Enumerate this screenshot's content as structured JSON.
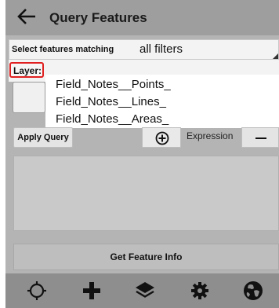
{
  "header": {
    "title": "Query Features",
    "back_icon": "back-arrow-icon"
  },
  "filter": {
    "label": "Select features matching",
    "value": "all filters"
  },
  "layer": {
    "label": "Layer:",
    "options": [
      "Field_Notes__Points_",
      "Field_Notes__Lines_",
      "Field_Notes__Areas_"
    ]
  },
  "controls": {
    "apply_label": "Apply Query",
    "add_icon": "plus-circle-icon",
    "expression_label": "Expression",
    "remove_icon": "minus-icon"
  },
  "footer": {
    "info_label": "Get Feature Info"
  },
  "bottom_nav": {
    "icons": [
      "crosshair-icon",
      "plus-icon",
      "layers-icon",
      "gear-icon",
      "globe-icon"
    ]
  },
  "colors": {
    "highlight": "#e02020"
  }
}
